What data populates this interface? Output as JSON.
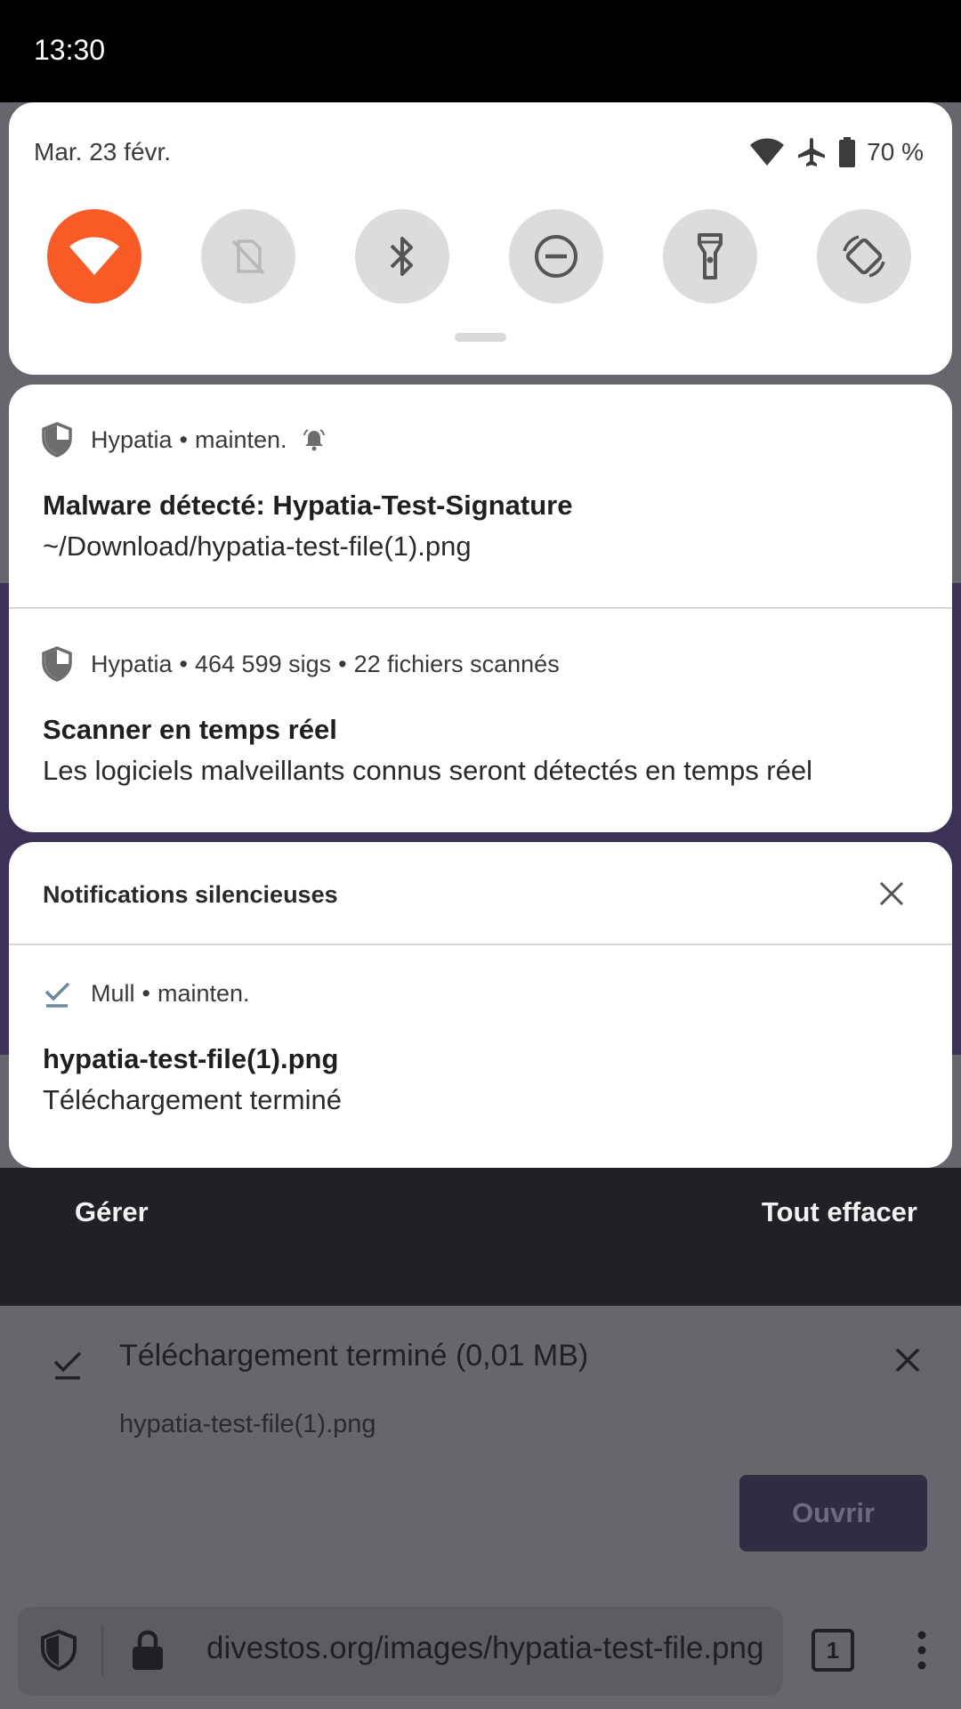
{
  "status_bar": {
    "time": "13:30"
  },
  "quick_settings": {
    "date": "Mar. 23 févr.",
    "battery": "70 %",
    "tiles": [
      {
        "name": "wifi",
        "icon": "wifi-icon",
        "active": true
      },
      {
        "name": "mobile-data",
        "icon": "no-sim-icon",
        "active": false
      },
      {
        "name": "bluetooth",
        "icon": "bluetooth-icon",
        "active": false
      },
      {
        "name": "do-not-disturb",
        "icon": "do-not-disturb-icon",
        "active": false
      },
      {
        "name": "flashlight",
        "icon": "flashlight-icon",
        "active": false
      },
      {
        "name": "auto-rotate",
        "icon": "rotate-icon",
        "active": false
      }
    ],
    "colors": {
      "active_tile": "#f95b27",
      "inactive_tile": "#dcdcdc"
    }
  },
  "notifications": [
    {
      "app": "Hypatia",
      "meta": "mainten.",
      "icon": "shield-icon",
      "alert_icon": "bell-alert-icon",
      "title": "Malware détecté: Hypatia-Test-Signature",
      "body": "~/Download/hypatia-test-file(1).png"
    },
    {
      "app": "Hypatia",
      "meta": "464 599 sigs",
      "meta2": "22 fichiers scannés",
      "icon": "shield-icon",
      "title": "Scanner en temps réel",
      "body": "Les logiciels malveillants connus seront détectés en temps réel"
    }
  ],
  "silent_section": {
    "header": "Notifications silencieuses",
    "items": [
      {
        "app": "Mull",
        "meta": "mainten.",
        "icon": "download-done-icon",
        "title": "hypatia-test-file(1).png",
        "body": "Téléchargement terminé"
      }
    ]
  },
  "shade_footer": {
    "manage": "Gérer",
    "clear_all": "Tout effacer"
  },
  "browser": {
    "download_title": "Téléchargement terminé (0,01 MB)",
    "download_file": "hypatia-test-file(1).png",
    "open_button": "Ouvrir",
    "url": "divestos.org/images/hypatia-test-file.png",
    "tab_count": "1"
  }
}
